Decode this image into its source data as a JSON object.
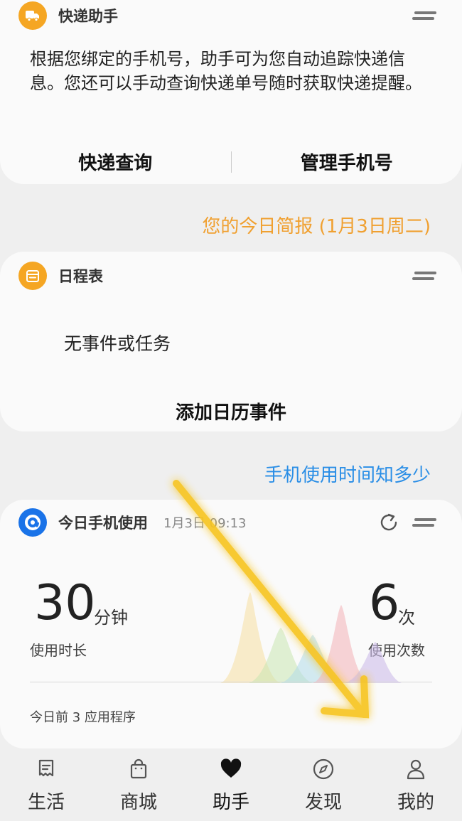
{
  "express_card": {
    "title": "快递助手",
    "description": "根据您绑定的手机号，助手可为您自动追踪快递信息。您还可以手动查询快递单号随时获取快递提醒。",
    "query_label": "快递查询",
    "manage_label": "管理手机号",
    "icon": "package-icon",
    "accent": "#f5a623"
  },
  "daily_brief_link": "您的今日简报 (1月3日周二)",
  "schedule_card": {
    "title": "日程表",
    "empty_text": "无事件或任务",
    "add_label": "添加日历事件",
    "icon": "calendar-icon",
    "accent": "#f5a623"
  },
  "usage_link": "手机使用时间知多少",
  "usage_card": {
    "title": "今日手机使用",
    "date": "1月3日 09:13",
    "duration_value": "30",
    "duration_unit": "分钟",
    "duration_label": "使用时长",
    "count_value": "6",
    "count_unit": "次",
    "count_label": "使用次数",
    "top_apps_label": "今日前 3 应用程序",
    "icon": "usage-icon",
    "accent": "#1a73e8"
  },
  "colors": {
    "link_orange": "#f0a030",
    "link_blue": "#2a8ee6",
    "background": "#efefef",
    "card": "#fafafa"
  },
  "bottom_nav": [
    {
      "label": "生活",
      "icon": "life-icon",
      "active": false
    },
    {
      "label": "商城",
      "icon": "shopping-bag-icon",
      "active": false
    },
    {
      "label": "助手",
      "icon": "heart-icon",
      "active": true
    },
    {
      "label": "发现",
      "icon": "compass-icon",
      "active": false
    },
    {
      "label": "我的",
      "icon": "person-icon",
      "active": false
    }
  ]
}
